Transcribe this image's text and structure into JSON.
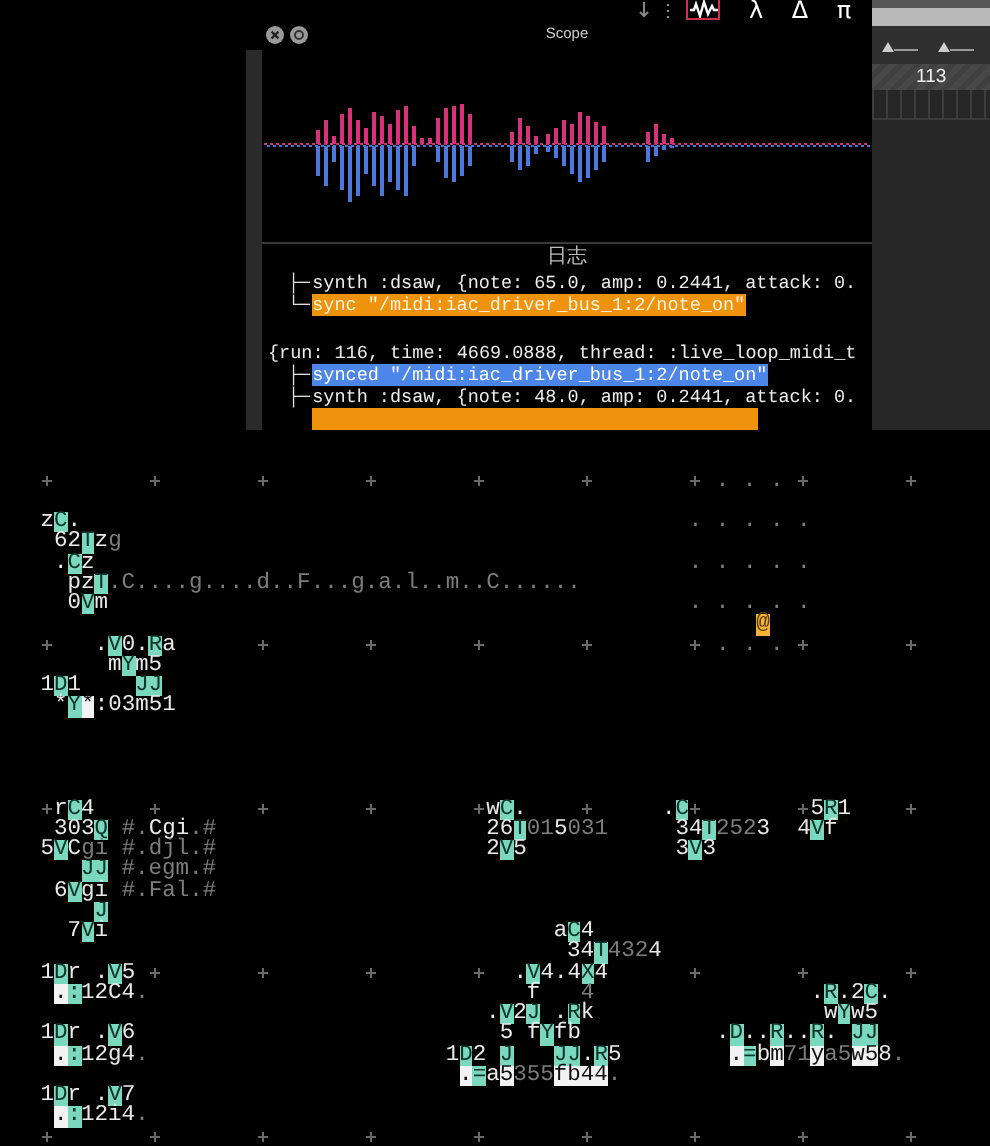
{
  "toolbar": [
    {
      "kind": "arrow",
      "selected": false
    },
    {
      "kind": "dots",
      "selected": false
    },
    {
      "kind": "scope",
      "selected": true
    },
    {
      "kind": "glyph",
      "text": "λ",
      "selected": false
    },
    {
      "kind": "glyph",
      "text": "Δ",
      "selected": false
    },
    {
      "kind": "glyph",
      "text": "π",
      "selected": false
    }
  ],
  "scope": {
    "title": "Scope"
  },
  "log": {
    "title": "日志",
    "entries": [
      {
        "kind": "line",
        "branch": "├─",
        "text": "synth :dsaw, {note: 65.0, amp: 0.2441, attack: 0."
      },
      {
        "kind": "sync",
        "branch": "└─",
        "text": "sync \"/midi:iac_driver_bus_1:2/note_on\""
      },
      {
        "kind": "gap"
      },
      {
        "kind": "header",
        "text": "{run: 116, time: 4669.0888, thread: :live_loop_midi_t"
      },
      {
        "kind": "synced",
        "branch": "├─",
        "text": "synced \"/midi:iac_driver_bus_1:2/note_on\""
      },
      {
        "kind": "line",
        "branch": "├─",
        "text": "synth :dsaw, {note: 48.0, amp: 0.2441, attack: 0."
      },
      {
        "kind": "sync"
      }
    ]
  },
  "timeline": {
    "bar": "113"
  },
  "grid": {
    "rows": [
      {},
      {},
      {
        "runs": [
          {
            "text": "                                                     . . .",
            "kind": "dim"
          }
        ]
      },
      {},
      {
        "runs": [
          {
            "text": "   z",
            "kind": "plain"
          },
          {
            "text": "C",
            "kind": "op"
          },
          {
            "text": ".                                             ",
            "kind": "plain"
          },
          {
            "text": ". . . . .",
            "kind": "dim"
          }
        ]
      },
      {
        "runs": [
          {
            "text": "    62",
            "kind": "plain"
          },
          {
            "text": "T",
            "kind": "op"
          },
          {
            "text": "z",
            "kind": "plain"
          },
          {
            "text": "g",
            "kind": "dim"
          }
        ]
      },
      {
        "runs": [
          {
            "text": "    .",
            "kind": "plain"
          },
          {
            "text": "C",
            "kind": "op"
          },
          {
            "text": "z                                            ",
            "kind": "plain"
          },
          {
            "text": ". . . . .",
            "kind": "dim"
          }
        ]
      },
      {
        "runs": [
          {
            "text": "     pz",
            "kind": "plain"
          },
          {
            "text": "T",
            "kind": "op"
          },
          {
            "text": ".C....g....d..F...g.a.l..m..C......",
            "kind": "dim"
          }
        ]
      },
      {
        "runs": [
          {
            "text": "     0",
            "kind": "plain"
          },
          {
            "text": "V",
            "kind": "op"
          },
          {
            "text": "m                                           ",
            "kind": "plain"
          },
          {
            "text": ". . . . .",
            "kind": "dim"
          }
        ]
      },
      {
        "runs": [
          {
            "text": "                                                        @",
            "kind": "cursor"
          }
        ]
      },
      {
        "runs": [
          {
            "text": "       .",
            "kind": "plain"
          },
          {
            "text": "V",
            "kind": "op"
          },
          {
            "text": "0.",
            "kind": "plain"
          },
          {
            "text": "R",
            "kind": "op"
          },
          {
            "text": "a                                        ",
            "kind": "plain"
          },
          {
            "text": ". . .",
            "kind": "dim"
          }
        ]
      },
      {
        "runs": [
          {
            "text": "        m",
            "kind": "plain"
          },
          {
            "text": "Y",
            "kind": "op"
          },
          {
            "text": "m5",
            "kind": "plain"
          }
        ]
      },
      {
        "runs": [
          {
            "text": "   1",
            "kind": "plain"
          },
          {
            "text": "D",
            "kind": "op"
          },
          {
            "text": "1    ",
            "kind": "plain"
          },
          {
            "text": "JJ",
            "kind": "op"
          }
        ]
      },
      {
        "runs": [
          {
            "text": "    *",
            "kind": "plain"
          },
          {
            "text": "Y",
            "kind": "op"
          },
          {
            "text": "*",
            "kind": "hl"
          },
          {
            "text": ":03m51",
            "kind": "plain"
          }
        ]
      },
      {},
      {},
      {},
      {},
      {
        "runs": [
          {
            "text": "    r",
            "kind": "plain"
          },
          {
            "text": "C",
            "kind": "op"
          },
          {
            "text": "4                             w",
            "kind": "plain"
          },
          {
            "text": "C",
            "kind": "op"
          },
          {
            "text": ".          .",
            "kind": "plain"
          },
          {
            "text": "C",
            "kind": "op"
          },
          {
            "text": "         5",
            "kind": "plain"
          },
          {
            "text": "R",
            "kind": "op"
          },
          {
            "text": "1",
            "kind": "plain"
          }
        ]
      },
      {
        "runs": [
          {
            "text": "    303",
            "kind": "plain"
          },
          {
            "text": "Q",
            "kind": "op"
          },
          {
            "text": " #.",
            "kind": "dim"
          },
          {
            "text": "Cgi",
            "kind": "plain"
          },
          {
            "text": ".#",
            "kind": "dim"
          },
          {
            "text": "                    26",
            "kind": "plain"
          },
          {
            "text": "T",
            "kind": "op"
          },
          {
            "text": "01",
            "kind": "dim"
          },
          {
            "text": "5",
            "kind": "plain"
          },
          {
            "text": "031",
            "kind": "dim"
          },
          {
            "text": "     34",
            "kind": "plain"
          },
          {
            "text": "T",
            "kind": "op"
          },
          {
            "text": "252",
            "kind": "dim"
          },
          {
            "text": "3  4",
            "kind": "plain"
          },
          {
            "text": "V",
            "kind": "op"
          },
          {
            "text": "f",
            "kind": "plain"
          }
        ]
      },
      {
        "runs": [
          {
            "text": "   5",
            "kind": "plain"
          },
          {
            "text": "V",
            "kind": "op"
          },
          {
            "text": "C",
            "kind": "plain"
          },
          {
            "text": "gi",
            "kind": "dim"
          },
          {
            "text": " #.djl.#",
            "kind": "dim"
          },
          {
            "text": "                    2",
            "kind": "plain"
          },
          {
            "text": "V",
            "kind": "op"
          },
          {
            "text": "5           3",
            "kind": "plain"
          },
          {
            "text": "V",
            "kind": "op"
          },
          {
            "text": "3",
            "kind": "plain"
          }
        ]
      },
      {
        "runs": [
          {
            "text": "      JJ",
            "kind": "op"
          },
          {
            "text": " #.egm.#",
            "kind": "dim"
          }
        ]
      },
      {
        "runs": [
          {
            "text": "    6",
            "kind": "plain"
          },
          {
            "text": "V",
            "kind": "op"
          },
          {
            "text": "gi ",
            "kind": "plain"
          },
          {
            "text": "#.Fal.#",
            "kind": "dim"
          }
        ]
      },
      {
        "runs": [
          {
            "text": "       J",
            "kind": "op"
          }
        ]
      },
      {
        "runs": [
          {
            "text": "     7",
            "kind": "plain"
          },
          {
            "text": "V",
            "kind": "op"
          },
          {
            "text": "i                                 a",
            "kind": "plain"
          },
          {
            "text": "C",
            "kind": "op"
          },
          {
            "text": "4",
            "kind": "plain"
          }
        ]
      },
      {
        "runs": [
          {
            "text": "                                          34",
            "kind": "plain"
          },
          {
            "text": "T",
            "kind": "op"
          },
          {
            "text": "432",
            "kind": "dim"
          },
          {
            "text": "4",
            "kind": "plain"
          }
        ]
      },
      {
        "runs": [
          {
            "text": "   1",
            "kind": "plain"
          },
          {
            "text": "D",
            "kind": "op"
          },
          {
            "text": "r .",
            "kind": "plain"
          },
          {
            "text": "V",
            "kind": "op"
          },
          {
            "text": "5                            .",
            "kind": "plain"
          },
          {
            "text": "V",
            "kind": "op"
          },
          {
            "text": "4.4",
            "kind": "plain"
          },
          {
            "text": "X",
            "kind": "op"
          },
          {
            "text": "4",
            "kind": "plain"
          }
        ]
      },
      {
        "runs": [
          {
            "text": "    .",
            "kind": "hl"
          },
          {
            "text": ":",
            "kind": "op"
          },
          {
            "text": "12C4",
            "kind": "plain"
          },
          {
            "text": ".",
            "kind": "dim"
          },
          {
            "text": "                            f",
            "kind": "plain"
          },
          {
            "text": "   4",
            "kind": "dim"
          },
          {
            "text": "                .",
            "kind": "plain"
          },
          {
            "text": "R",
            "kind": "op"
          },
          {
            "text": ".2",
            "kind": "plain"
          },
          {
            "text": "C",
            "kind": "op"
          },
          {
            "text": ".",
            "kind": "plain"
          }
        ]
      },
      {
        "runs": [
          {
            "text": "                                    .",
            "kind": "plain"
          },
          {
            "text": "V",
            "kind": "op"
          },
          {
            "text": "2",
            "kind": "plain"
          },
          {
            "text": "J",
            "kind": "op"
          },
          {
            "text": " .",
            "kind": "plain"
          },
          {
            "text": "R",
            "kind": "op"
          },
          {
            "text": "k                 w",
            "kind": "plain"
          },
          {
            "text": "Y",
            "kind": "op"
          },
          {
            "text": "w5",
            "kind": "plain"
          }
        ]
      },
      {
        "runs": [
          {
            "text": "   1",
            "kind": "plain"
          },
          {
            "text": "D",
            "kind": "op"
          },
          {
            "text": "r .",
            "kind": "plain"
          },
          {
            "text": "V",
            "kind": "op"
          },
          {
            "text": "6                           5 f",
            "kind": "plain"
          },
          {
            "text": "Y",
            "kind": "op"
          },
          {
            "text": "fb          .",
            "kind": "plain"
          },
          {
            "text": "D",
            "kind": "op"
          },
          {
            "text": "..",
            "kind": "plain"
          },
          {
            "text": "R",
            "kind": "op"
          },
          {
            "text": "..",
            "kind": "plain"
          },
          {
            "text": "R",
            "kind": "op"
          },
          {
            "text": ". ",
            "kind": "plain"
          },
          {
            "text": "JJ",
            "kind": "op"
          }
        ]
      },
      {
        "runs": [
          {
            "text": "    .",
            "kind": "hl"
          },
          {
            "text": ":",
            "kind": "op"
          },
          {
            "text": "12g4",
            "kind": "plain"
          },
          {
            "text": ".",
            "kind": "dim"
          },
          {
            "text": "                      1",
            "kind": "plain"
          },
          {
            "text": "D",
            "kind": "op"
          },
          {
            "text": "2 ",
            "kind": "plain"
          },
          {
            "text": "J",
            "kind": "op"
          },
          {
            "text": "   JJ",
            "kind": "op"
          },
          {
            "text": ".",
            "kind": "plain"
          },
          {
            "text": "R",
            "kind": "op"
          },
          {
            "text": "5        ",
            "kind": "plain"
          },
          {
            "text": ".",
            "kind": "hl"
          },
          {
            "text": "=",
            "kind": "op"
          },
          {
            "text": "b",
            "kind": "plain"
          },
          {
            "text": "m",
            "kind": "hl"
          },
          {
            "text": "71",
            "kind": "dim"
          },
          {
            "text": "y",
            "kind": "hl"
          },
          {
            "text": "a5",
            "kind": "dim"
          },
          {
            "text": "w5",
            "kind": "hl"
          },
          {
            "text": "8",
            "kind": "plain"
          },
          {
            "text": ".",
            "kind": "dim"
          }
        ]
      },
      {
        "runs": [
          {
            "text": "                                  .",
            "kind": "hl"
          },
          {
            "text": "=",
            "kind": "op"
          },
          {
            "text": "a",
            "kind": "plain"
          },
          {
            "text": "5",
            "kind": "hl"
          },
          {
            "text": "355",
            "kind": "dim"
          },
          {
            "text": "fb44",
            "kind": "hl"
          },
          {
            "text": ".",
            "kind": "dim"
          }
        ]
      },
      {
        "runs": [
          {
            "text": "   1",
            "kind": "plain"
          },
          {
            "text": "D",
            "kind": "op"
          },
          {
            "text": "r .",
            "kind": "plain"
          },
          {
            "text": "V",
            "kind": "op"
          },
          {
            "text": "7",
            "kind": "plain"
          }
        ]
      },
      {
        "runs": [
          {
            "text": "    .",
            "kind": "hl"
          },
          {
            "text": ":",
            "kind": "op"
          },
          {
            "text": "12i4",
            "kind": "plain"
          },
          {
            "text": ".",
            "kind": "dim"
          }
        ]
      },
      {}
    ]
  }
}
